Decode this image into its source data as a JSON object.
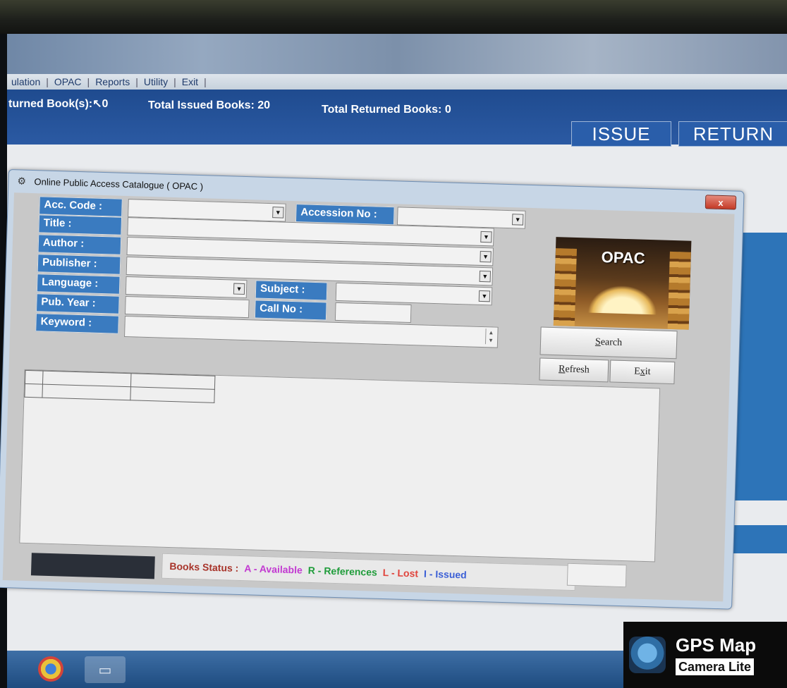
{
  "menu": {
    "items": [
      "ulation",
      "OPAC",
      "Reports",
      "Utility",
      "Exit"
    ]
  },
  "status": {
    "returned_today": "turned Book(s):",
    "returned_today_value": "0",
    "total_issued": "Total Issued Books: 20",
    "total_returned": "Total Returned Books: 0",
    "issue_button": "ISSUE",
    "return_button": "RETURN"
  },
  "dialog": {
    "title": "Online Public Access Catalogue ( OPAC )",
    "close_label": "x",
    "fields": {
      "acc_code": "Acc. Code :",
      "accession_no": "Accession No :",
      "title": "Title :",
      "author": "Author :",
      "publisher": "Publisher :",
      "language": "Language :",
      "subject": "Subject :",
      "pub_year": "Pub. Year :",
      "call_no": "Call No :",
      "keyword": "Keyword :"
    },
    "image_text": "OPAC",
    "buttons": {
      "search_pre": "",
      "search_key": "S",
      "search_post": "earch",
      "refresh_key": "R",
      "refresh_post": "efresh",
      "exit_pre": "E",
      "exit_key": "x",
      "exit_post": "it"
    },
    "legend": {
      "label": "Books Status :",
      "available": "A - Available",
      "references": "R - References",
      "lost": "L - Lost",
      "issued": "I - Issued"
    },
    "legend_colors": {
      "available": "#c23ad1",
      "references": "#1f9c3a",
      "lost": "#e0443c",
      "issued": "#3b5fd6"
    }
  },
  "watermark": {
    "title": "GPS Map",
    "subtitle": "Camera Lite"
  },
  "taskbar": {
    "icons": [
      "chrome-icon",
      "folder-icon"
    ]
  }
}
